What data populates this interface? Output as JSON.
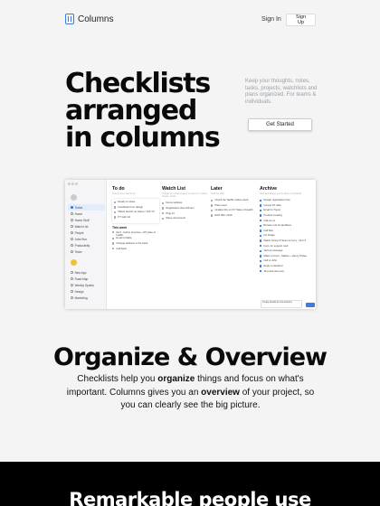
{
  "nav": {
    "logo_text": "Columns",
    "signin_label": "Sign In",
    "signup_label": "Sign Up"
  },
  "hero": {
    "title_lines": [
      "Checklists",
      "arranged",
      "in columns"
    ],
    "description": "Keep your thoughts, notes, tasks, projects, watchlists and plans organized. For teams & individuals.",
    "cta_label": "Get Started"
  },
  "app": {
    "sidebar": {
      "items_top": [
        "Todos",
        "Home",
        "Home Stuff",
        "Watch List",
        "People",
        "Jobs Run",
        "Productivity",
        "Team"
      ],
      "items_bottom": [
        "New App",
        "Road Map",
        "Weekly Sprints",
        "Design",
        "Marketing"
      ]
    },
    "columns": [
      {
        "title": "To do",
        "subtitle": "Things you need to do",
        "card_tasks": [
          "Ready to share",
          "Feedback from design",
          "Watch launch on Game / 100 TV",
          "PT call coll"
        ],
        "subsection": "This week",
        "tasks": [
          "Nerf - Call to structure, 10? state of health",
          "Email to Mark",
          "Change address in the bank",
          "Call back"
        ]
      },
      {
        "title": "Watch List",
        "subtitle": "Things you want to keep an eye on, movies, shows, books",
        "tasks": [
          "Nemo Hollows",
          "Registration thus still test",
          "Plug Lit",
          "Wave documents"
        ]
      },
      {
        "title": "Later",
        "subtitle": "Stuff for later",
        "tasks": [
          "Check the Netflix culture deck",
          "Plant seed",
          "Update info on NY State of Health",
          "ECD 500, 2019"
        ]
      },
      {
        "title": "Archive",
        "subtitle": "Stuff and things you've done or archived",
        "tasks": [
          "Design registration flow",
          "Cancel ST data",
          "Email to Trevor",
          "Product meeting",
          "Call w/ LA",
          "Browse role for landlines",
          "Call Mat",
          "Fix bridge",
          "Watch Group & Sean w/ Lucy - SLC 5",
          "Form for support mail",
          "Tell top message",
          "Make a Cover - Makes + Henry Prolee",
          "Call to John",
          "Reply to landlord",
          "Text web site post"
        ]
      }
    ],
    "create_placeholder": "Create boards for sub-sections"
  },
  "organize": {
    "title": "Organize & Overview",
    "text_parts": [
      "Checklists help you ",
      "organize",
      " things and focus on what's important. Columns gives you an ",
      "overview",
      " of your project, so you can clearly see the big picture."
    ]
  },
  "dark_section": {
    "title": "Remarkable people use"
  },
  "colors": {
    "accent": "#3d7be0",
    "background": "#f4f4f4",
    "dark": "#000000"
  }
}
